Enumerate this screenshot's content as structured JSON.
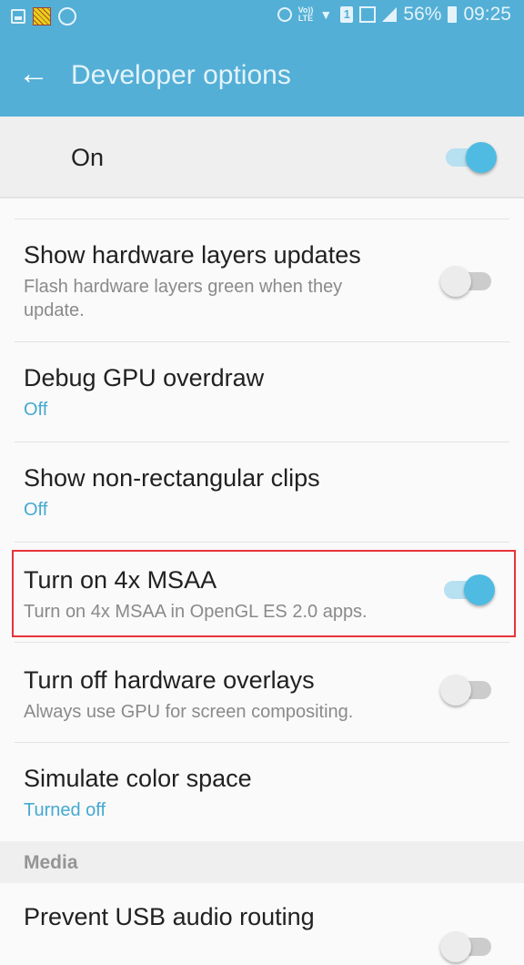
{
  "status_bar": {
    "left_icons": [
      "gallery-icon",
      "pattern-app-icon",
      "whatsapp-icon"
    ],
    "right_icons": [
      "alarm-icon",
      "volte-icon",
      "wifi-icon",
      "sim-1-icon",
      "signal-sim1-icon",
      "signal-sim2-icon",
      "battery-icon"
    ],
    "volte_label_top": "Vo))",
    "volte_label_bottom": "LTE",
    "sim_label": "1",
    "battery_percent": "56%",
    "time": "09:25"
  },
  "app_bar": {
    "title": "Developer options",
    "back_icon": "arrow-left-icon",
    "background_color": "#53afd6"
  },
  "master_switch": {
    "label": "On",
    "state": true
  },
  "items": [
    {
      "title": "Show hardware layers updates",
      "subtitle": "Flash hardware layers green when they update.",
      "toggle": false
    },
    {
      "title": "Debug GPU overdraw",
      "value": "Off"
    },
    {
      "title": "Show non-rectangular clips",
      "value": "Off"
    },
    {
      "title": "Turn on 4x MSAA",
      "subtitle": "Turn on 4x MSAA in OpenGL ES 2.0 apps.",
      "toggle": true,
      "highlighted": true
    },
    {
      "title": "Turn off hardware overlays",
      "subtitle": "Always use GPU for screen compositing.",
      "toggle": false
    },
    {
      "title": "Simulate color space",
      "value": "Turned off"
    }
  ],
  "sections": {
    "media": "Media"
  },
  "media_items": [
    {
      "title": "Prevent USB audio routing",
      "toggle": false
    }
  ],
  "colors": {
    "accent": "#4fbbe3",
    "value_text": "#45a9d2",
    "highlight_border": "#e8333a"
  }
}
